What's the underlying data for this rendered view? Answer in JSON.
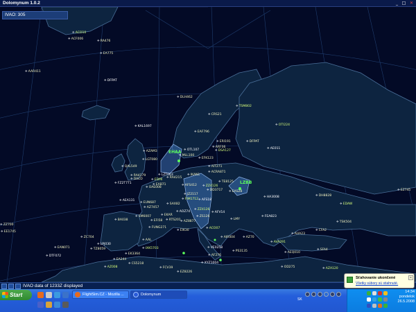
{
  "window": {
    "title": "Dolomynum 1.0.2",
    "minimize": "_",
    "maximize": "□",
    "close": "✕"
  },
  "map": {
    "client_count": "IVAO: 305",
    "atc": [
      "EHAA",
      "LZBB"
    ],
    "callsigns": [
      "ACO10",
      "ACF006",
      "RA476",
      "EA775",
      "AAR411",
      "DFPAT",
      "DLH462",
      "TSM802",
      "CRS21",
      "EAF796",
      "KAL1697",
      "ARF06",
      "ERI191",
      "DFPAT",
      "OTI224",
      "AE011",
      "QAL549",
      "AZAM3",
      "LGT080",
      "MLL100",
      "OTL107",
      "DSA127",
      "EFK123",
      "AIT271",
      "RA4179",
      "LZT063",
      "IKAN1",
      "ACRA871",
      "EDMI",
      "RA4215",
      "FZ2T771",
      "DACD",
      "EAB71",
      "OAE008",
      "AFS412",
      "ZZ4126",
      "EAS28",
      "TE8125",
      "DD3717",
      "JZ2117",
      "HA3008",
      "DH8828",
      "EDAW",
      "EZ745",
      "ZZ700",
      "AEA131",
      "EUN687",
      "AZ7457",
      "SAX82",
      "FIM1712",
      "AFS18",
      "SM6007",
      "BA038",
      "EKAR",
      "EFI58",
      "AOZ74",
      "ZZ4126",
      "FUNG271",
      "RTS201",
      "AZ8877",
      "AFV14",
      "ZS126",
      "EIK30",
      "ACO07",
      "LMY",
      "FEA823",
      "AUA23",
      "CFA2",
      "AIR004",
      "AZ70",
      "AVA291",
      "AEQ010",
      "TSK504",
      "EE1745",
      "ZC704",
      "LPJ030",
      "AAL",
      "IXK5703",
      "EAN071",
      "TZ8059",
      "DTF072",
      "EK3364",
      "CS5218",
      "EA244",
      "AZ008",
      "VE0258",
      "PS3135",
      "EZ8226",
      "SFA4",
      "AF276",
      "XYZ1004",
      "AZA120",
      "OD275",
      "FCV39"
    ]
  },
  "status_bar": {
    "text": "IVAO data of 1233Z displayed"
  },
  "taskbar": {
    "start_label": "Start",
    "tasks": [
      "FlightSim.CZ - Mozilla ...",
      "Dolomynum"
    ],
    "lang": "SK",
    "clock_time": "14:34",
    "clock_day": "pondelok",
    "clock_date": "26.5.2008"
  },
  "balloon": {
    "title": "Sťahovanie ukončené",
    "link": "Všetky súbory sú stiahnuté."
  },
  "colors": {
    "map_background": "#030a26",
    "land": "#0d2440",
    "coast": "#4a6f99",
    "grid": "#1f3d6e",
    "callsign": "#f2f2c0",
    "atc": "#5cff5c",
    "taskbar": "#245edb",
    "start": "#2f8a2f"
  }
}
